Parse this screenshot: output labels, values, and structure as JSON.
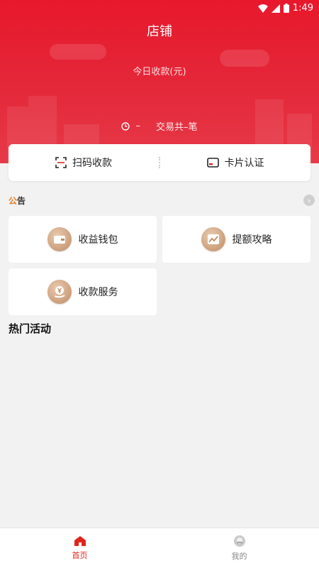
{
  "status_bar": {
    "time": "1:49"
  },
  "header": {
    "title": "店铺"
  },
  "summary": {
    "today_label": "今日收款(元)",
    "trade_value": "–",
    "trade_label": "交易共–笔"
  },
  "actions": [
    {
      "label": "扫码收款",
      "icon": "scan-icon"
    },
    {
      "label": "卡片认证",
      "icon": "card-icon"
    }
  ],
  "notice": {
    "badge_left": "公",
    "badge_right": "告"
  },
  "tiles": [
    {
      "label": "收益钱包",
      "icon": "wallet-icon"
    },
    {
      "label": "提额攻略",
      "icon": "trend-icon"
    },
    {
      "label": "收款服务",
      "icon": "yen-hand-icon"
    }
  ],
  "hot_section": {
    "title": "热门活动"
  },
  "bottom_nav": [
    {
      "label": "首页",
      "icon": "home-icon",
      "active": true
    },
    {
      "label": "我的",
      "icon": "profile-icon",
      "active": false
    }
  ],
  "colors": {
    "brand_red": "#e8182c",
    "active_tab": "#e1251b",
    "tile_icon": "#c08a62"
  }
}
